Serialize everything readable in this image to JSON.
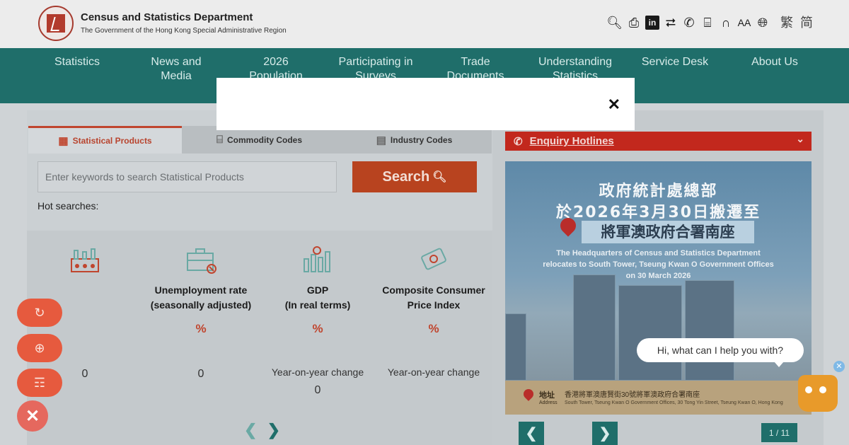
{
  "header": {
    "dept_name": "Census and Statistics Department",
    "dept_sub": "The Government of the Hong Kong Special Administrative Region",
    "lang_trad": "繁",
    "lang_simp": "简",
    "font_size_label": "AA",
    "linkedin_label": "in"
  },
  "nav": {
    "items": [
      "Statistics",
      "News and\nMedia",
      "2026\nPopulation",
      "Participating in\nSurveys",
      "Trade\nDocuments",
      "Understanding\nStatistics",
      "Service Desk",
      "About Us"
    ]
  },
  "modal": {
    "close_label": "✕"
  },
  "tabs": [
    {
      "label": "Statistical Products"
    },
    {
      "label": "Commodity Codes"
    },
    {
      "label": "Industry Codes"
    }
  ],
  "search": {
    "placeholder": "Enter keywords to search Statistical Products",
    "button_label": "Search",
    "hot_searches_label": "Hot searches:"
  },
  "cards": [
    {
      "title": "",
      "unit": "",
      "note": "",
      "values": [
        "0"
      ]
    },
    {
      "title": "Unemployment rate\n(seasonally adjusted)",
      "unit": "%",
      "note": "",
      "values": [
        "0"
      ]
    },
    {
      "title": "GDP\n(In real terms)",
      "unit": "%",
      "note": "Year-on-year change",
      "values": [
        "0"
      ]
    },
    {
      "title": "Composite Consumer\nPrice Index",
      "unit": "%",
      "note": "Year-on-year change",
      "values": []
    }
  ],
  "enquiry": {
    "label": "Enquiry Hotlines"
  },
  "banner": {
    "zh_line1": "政府統計處總部",
    "zh_line2": "於2026年3月30日搬遷至",
    "zh_location": "將軍澳政府合署南座",
    "en_line1": "The Headquarters of Census and Statistics Department",
    "en_line2": "relocates to South Tower, Tseung Kwan O Government Offices",
    "en_line3": "on 30 March 2026",
    "foot_label": "地址",
    "foot_label_en": "Address",
    "foot_addr": "香港將軍澳唐賢街30號將軍澳政府合署南座",
    "foot_addr_en": "South Tower, Tseung Kwan O Government Offices, 30 Tong Yin Street, Tseung Kwan O, Hong Kong"
  },
  "slides": {
    "counter": "1 / 11"
  },
  "chat": {
    "bubble_text": "Hi, what can I help you with?"
  },
  "colors": {
    "nav_bg": "#1f6e6a",
    "accent_red": "#c2281d",
    "search_btn": "#b8431f",
    "fab": "#e65a3e"
  }
}
